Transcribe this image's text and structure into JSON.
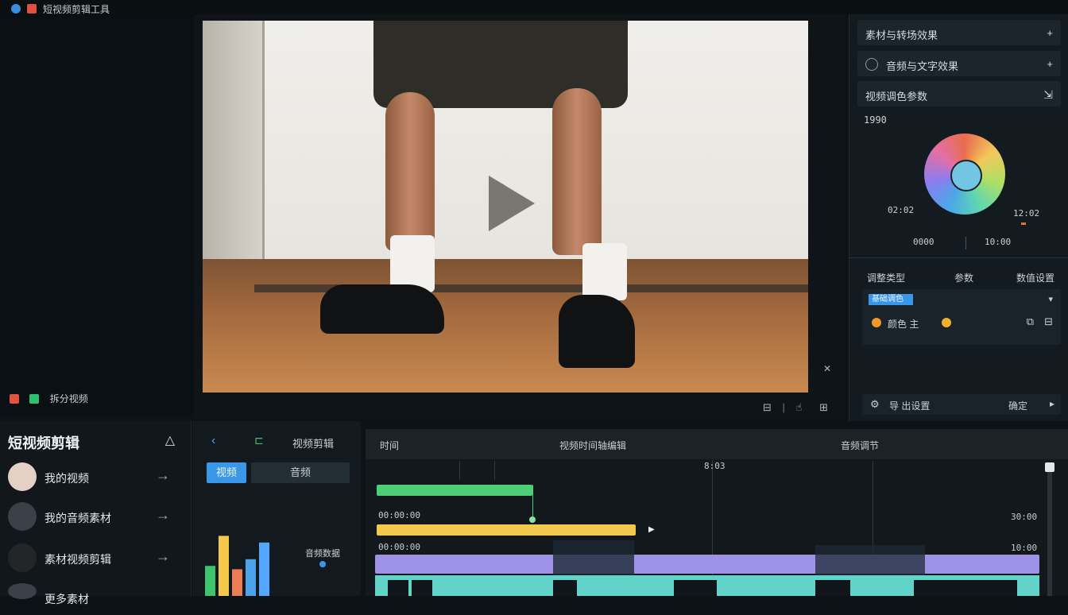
{
  "titlebar": {
    "title": "短视频剪辑工具",
    "colors": {
      "blue": "#3b8de0",
      "red": "#e05045"
    }
  },
  "viewer": {
    "play_icon": "play-icon",
    "corner_icon": "collapse-icon",
    "controls": [
      "fit-icon",
      "separator",
      "hand-icon",
      "grid-icon"
    ],
    "info_label": "拆分视频",
    "info_icons": [
      "record-icon",
      "chat-icon"
    ]
  },
  "right_panel": {
    "rows": [
      {
        "label": "素材与转场效果",
        "action": "+"
      },
      {
        "label": "音频与文字效果",
        "action": "+"
      },
      {
        "label": "视频调色参数",
        "action": "⇲"
      }
    ],
    "color_wheel": {
      "top_value": "1990",
      "left_value": "02:02",
      "right_value": "12:02",
      "bottom_left": "0000",
      "bottom_right": "10:00",
      "accent": "#e8742a"
    },
    "columns": [
      "调整类型",
      "参数",
      "数值设置"
    ],
    "selected_item": "基础调色",
    "item_row": {
      "label": "颜色 主",
      "icons": [
        "orange-dot-icon",
        "orange-dot-icon",
        "copy-icon"
      ]
    },
    "footer": {
      "left_label": "导 出设置",
      "right_label": "确定"
    }
  },
  "project_panel": {
    "title": "短视频剪辑",
    "items": [
      {
        "label": "我的视频"
      },
      {
        "label": "我的音频素材"
      },
      {
        "label": "素材视频剪辑"
      },
      {
        "label": "更多素材"
      }
    ]
  },
  "media_panel": {
    "title": "视频剪辑",
    "tabs": [
      "视频",
      "音频"
    ],
    "graph_label": "音频数据",
    "bars": [
      {
        "h": 0.45,
        "color": "#3ec46d"
      },
      {
        "h": 0.9,
        "color": "#f4c94a"
      },
      {
        "h": 0.4,
        "color": "#ec7b56"
      },
      {
        "h": 0.55,
        "color": "#4aa3e8"
      },
      {
        "h": 0.8,
        "color": "#53a7ff"
      }
    ]
  },
  "timeline": {
    "header_left": "时间",
    "header_center": "视频时间轴编辑",
    "header_right": "音频调节",
    "markers": {
      "top": "8:03",
      "track1": "00:00:00",
      "track2": "00:00:00"
    },
    "right_times": [
      "30:00",
      "10:00"
    ],
    "tracks": [
      {
        "name": "green",
        "color": "#4ccf76"
      },
      {
        "name": "yellow",
        "color": "#f2c94c"
      },
      {
        "name": "purple",
        "color": "#9d92e6"
      },
      {
        "name": "teal",
        "color": "#61d3c8"
      }
    ]
  }
}
